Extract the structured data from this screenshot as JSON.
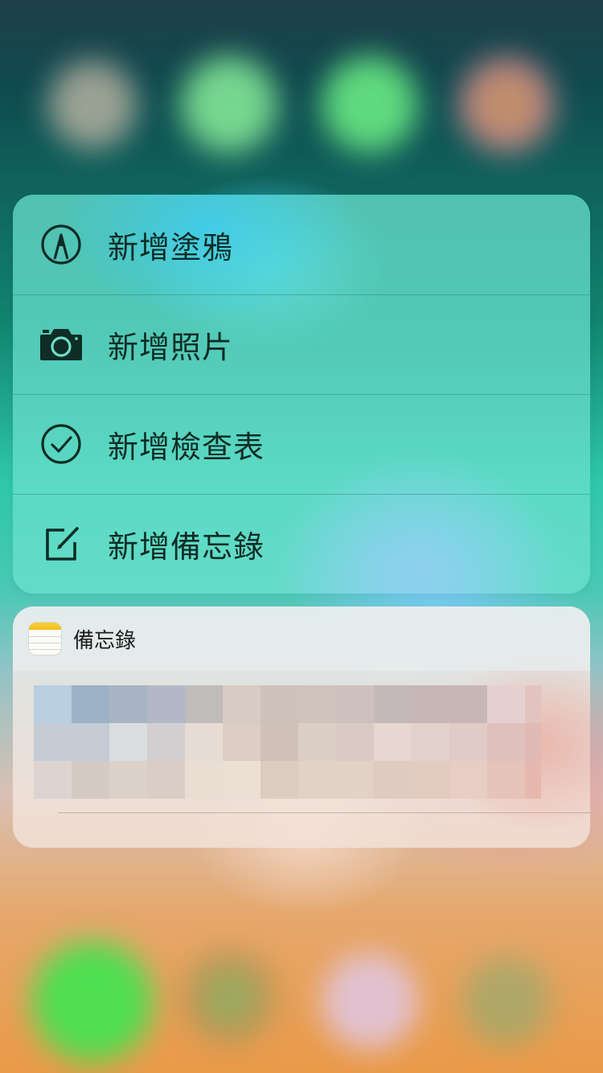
{
  "menu": {
    "items": [
      {
        "label": "新增塗鴉",
        "icon": "sketch-pen-icon"
      },
      {
        "label": "新增照片",
        "icon": "camera-icon"
      },
      {
        "label": "新增檢查表",
        "icon": "checklist-icon"
      },
      {
        "label": "新增備忘錄",
        "icon": "compose-note-icon"
      }
    ]
  },
  "widget": {
    "app_name": "備忘錄",
    "app_icon": "notes-app-icon",
    "content_state": "pixelated-hidden"
  },
  "colors": {
    "menu_text": "#0e2d26",
    "notes_icon_yellow": "#f0bd1c"
  }
}
